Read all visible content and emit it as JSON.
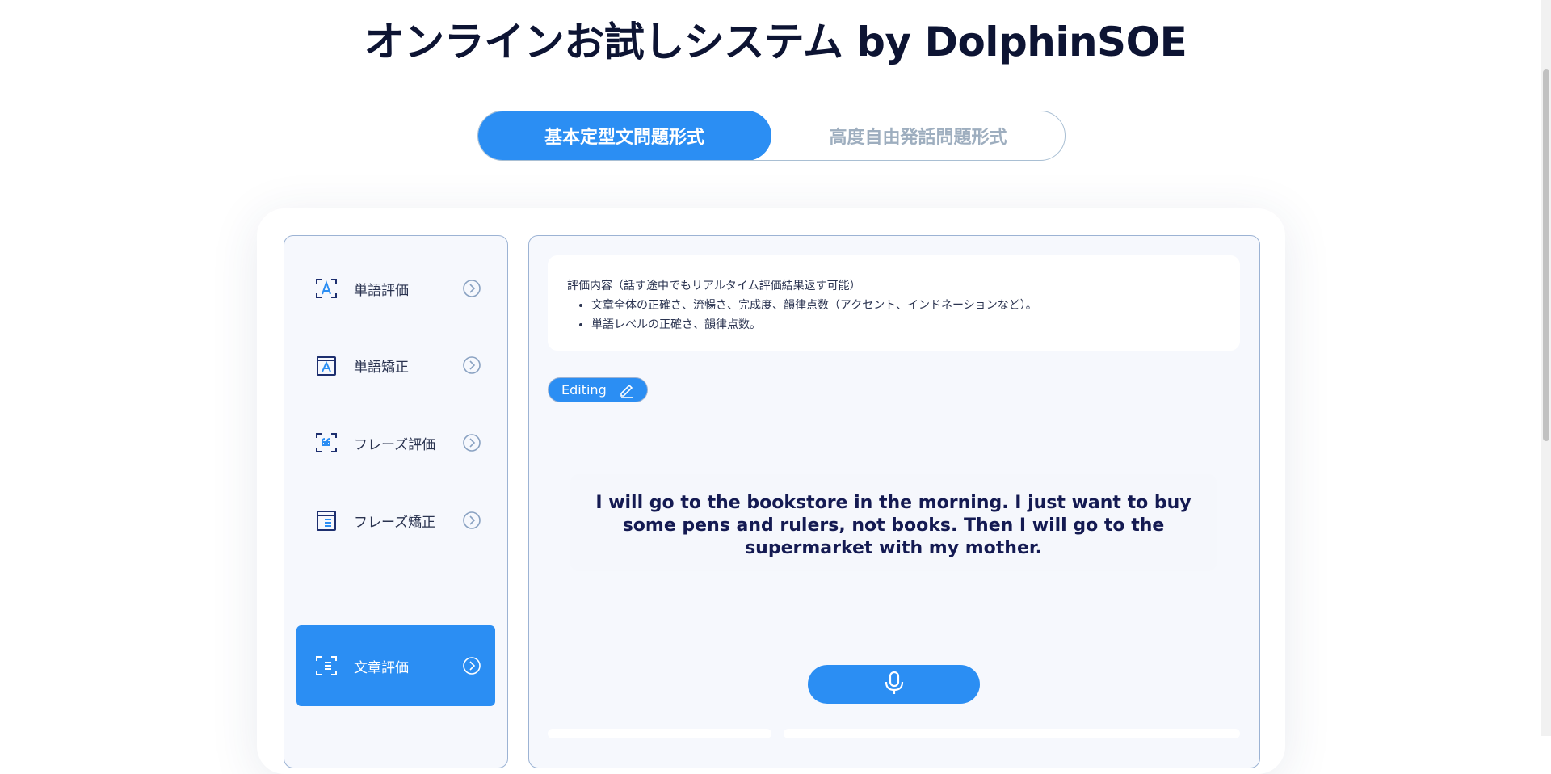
{
  "page": {
    "title": "オンラインお試しシステム by DolphinSOE"
  },
  "mode_switch": {
    "tabs": [
      {
        "label": "基本定型文問題形式",
        "active": true
      },
      {
        "label": "高度自由発話問題形式",
        "active": false
      }
    ]
  },
  "sidebar": {
    "items": [
      {
        "label": "単語評価",
        "icon": "letter-a-frame-icon",
        "active": false
      },
      {
        "label": "単語矯正",
        "icon": "letter-a-book-icon",
        "active": false
      },
      {
        "label": "フレーズ評価",
        "icon": "quote-frame-icon",
        "active": false
      },
      {
        "label": "フレーズ矯正",
        "icon": "list-book-icon",
        "active": false
      },
      {
        "label": "文章評価",
        "icon": "list-frame-icon",
        "active": true
      }
    ]
  },
  "info": {
    "heading": "評価内容（話す途中でもリアルタイム評価結果返す可能）",
    "points": [
      "文章全体の正確さ、流暢さ、完成度、韻律点数（アクセント、インドネーションなど）。",
      "単語レベルの正確さ、韻律点数。"
    ]
  },
  "editor": {
    "badge_label": "Editing",
    "badge_icon": "pencil-icon",
    "sentence": "I will go to the bookstore in the morning. I just want to buy some pens and rulers, not books. Then I will go to the supermarket with my mother."
  },
  "record": {
    "icon": "microphone-icon"
  },
  "colors": {
    "accent": "#2b8ef3",
    "title": "#0d1433",
    "border": "#9cb3d4"
  }
}
